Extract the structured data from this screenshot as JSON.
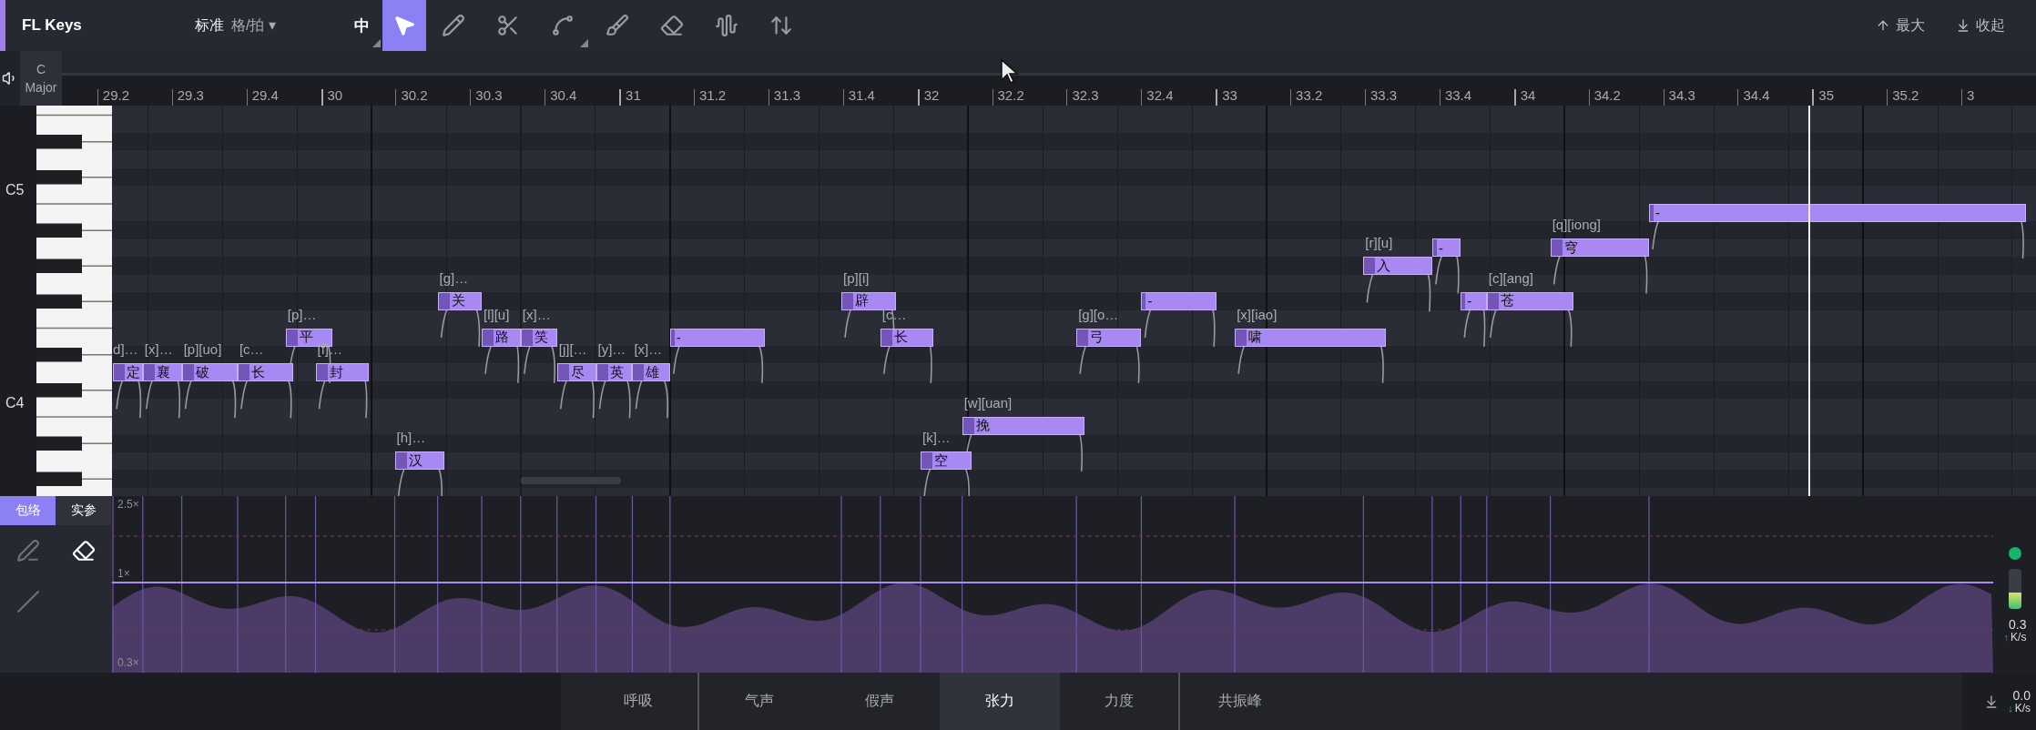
{
  "toolbar": {
    "app_title": "FL Keys",
    "grid_mode": "标准",
    "grid_unit": "格/拍 ▾",
    "density": {
      "label": "中",
      "menu": true
    },
    "tools": [
      {
        "kind": "select",
        "selected": true,
        "menu": false
      },
      {
        "kind": "pencil",
        "selected": false,
        "menu": false
      },
      {
        "kind": "scissors",
        "selected": false,
        "menu": false
      },
      {
        "kind": "curve",
        "selected": false,
        "menu": true
      },
      {
        "kind": "brush",
        "selected": false,
        "menu": false
      },
      {
        "kind": "eraser",
        "selected": false,
        "menu": false
      },
      {
        "kind": "wave",
        "selected": false,
        "menu": false
      },
      {
        "kind": "swap",
        "selected": false,
        "menu": false
      }
    ],
    "buttons": [
      {
        "kind": "maximize",
        "label": "最大"
      },
      {
        "kind": "collapse",
        "label": "收起"
      }
    ]
  },
  "key": {
    "tonic": "C",
    "mode": "Major"
  },
  "ruler": [
    "29.2",
    "29.3",
    "29.4",
    "30",
    "30.2",
    "30.3",
    "30.4",
    "31",
    "31.2",
    "31.3",
    "31.4",
    "32",
    "32.2",
    "32.3",
    "32.4",
    "33",
    "33.2",
    "33.3",
    "33.4",
    "34",
    "34.2",
    "34.3",
    "34.4",
    "35",
    "35.2",
    "3"
  ],
  "keyboard_labels": [
    "C5",
    "C4"
  ],
  "notes": [
    {
      "lyric": "定",
      "phonemes": "d]…"
    },
    {
      "lyric": "襄",
      "phonemes": "[x]…"
    },
    {
      "lyric": "破",
      "phonemes": "[p][uo]"
    },
    {
      "lyric": "长",
      "phonemes": "[c…"
    },
    {
      "lyric": "平",
      "phonemes": "[p]…"
    },
    {
      "lyric": "封",
      "phonemes": "[f]…"
    },
    {
      "lyric": "汉",
      "phonemes": "[h]…"
    },
    {
      "lyric": "关",
      "phonemes": "[g]…"
    },
    {
      "lyric": "路",
      "phonemes": "[l][u]"
    },
    {
      "lyric": "笑",
      "phonemes": "[x]…"
    },
    {
      "lyric": "尽",
      "phonemes": "[j][…"
    },
    {
      "lyric": "英",
      "phonemes": "[y]…"
    },
    {
      "lyric": "雄",
      "phonemes": "[x]…"
    },
    {
      "lyric": "-"
    },
    {
      "lyric": "辟",
      "phonemes": "[p][i]"
    },
    {
      "lyric": "长",
      "phonemes": "[c…"
    },
    {
      "lyric": "空",
      "phonemes": "[k]…"
    },
    {
      "lyric": "挽",
      "phonemes": "[w][uan]"
    },
    {
      "lyric": "弓",
      "phonemes": "[g][o…"
    },
    {
      "lyric": "-"
    },
    {
      "lyric": "啸",
      "phonemes": "[x][iao]"
    },
    {
      "lyric": "入",
      "phonemes": "[r][u]"
    },
    {
      "lyric": "-"
    },
    {
      "lyric": "-"
    },
    {
      "lyric": "苍",
      "phonemes": "[c][ang]"
    },
    {
      "lyric": "穹",
      "phonemes": "[q][iong]"
    },
    {
      "lyric": "-"
    }
  ],
  "param_panel": {
    "modes": [
      {
        "label": "包络",
        "selected": true
      },
      {
        "label": "实参",
        "selected": false
      }
    ],
    "tools": [
      {
        "kind": "draw",
        "selected": false
      },
      {
        "kind": "erase",
        "selected": true
      },
      {
        "kind": "line",
        "selected": false
      }
    ],
    "scale_labels": [
      "2.5×",
      "1×",
      "0.3×"
    ],
    "meter": {
      "level": 0.4
    },
    "rates": [
      {
        "value": "0.3",
        "unit": "K/s",
        "arrow": "↑"
      },
      {
        "value": "0.0",
        "unit": "K/s",
        "arrow": "↓"
      }
    ]
  },
  "param_tabs": [
    {
      "label": "呼吸",
      "selected": false,
      "divider_after": true
    },
    {
      "label": "气声",
      "selected": false,
      "divider_after": false
    },
    {
      "label": "假声",
      "selected": false,
      "divider_after": false
    },
    {
      "label": "张力",
      "selected": true,
      "divider_after": false
    },
    {
      "label": "力度",
      "selected": false,
      "divider_after": true
    },
    {
      "label": "共振峰",
      "selected": false,
      "divider_after": false
    }
  ]
}
